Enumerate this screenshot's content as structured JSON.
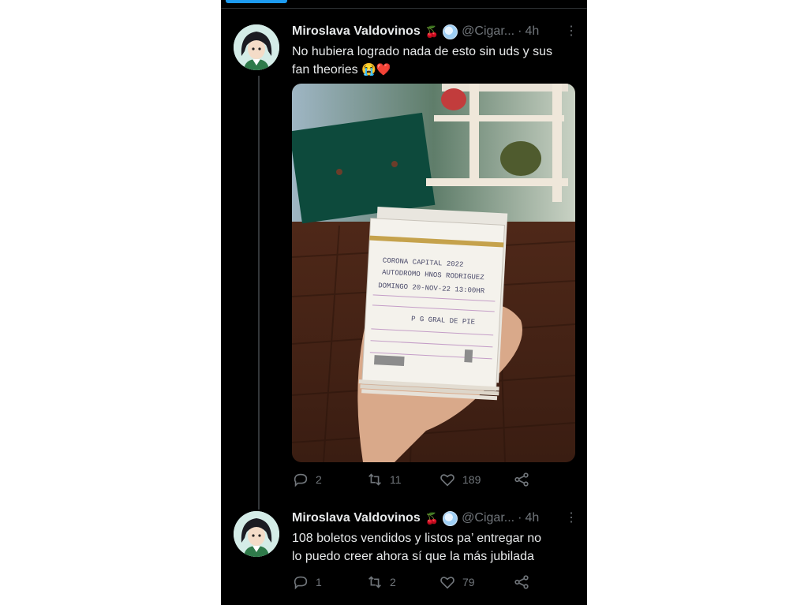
{
  "tweets": [
    {
      "author": "Miroslava Valdovinos",
      "badge_emoji": "🍒",
      "handle": "@Cigar...",
      "separator": "·",
      "time": "4h",
      "text_line1": "No hubiera logrado nada de esto sin uds y sus",
      "text_line2": "fan theories",
      "emojis": "😭❤️",
      "replies": "2",
      "retweets": "11",
      "likes": "189",
      "photo": {
        "ticket_lines": [
          "CORONA CAPITAL 2022",
          "AUTODROMO HNOS RODRIGUEZ",
          "DOMINGO  20-NOV-22 13:00HR",
          "P G GRAL DE PIE"
        ]
      }
    },
    {
      "author": "Miroslava Valdovinos",
      "badge_emoji": "🍒",
      "handle": "@Cigar...",
      "separator": "·",
      "time": "4h",
      "text_line1": "108 boletos vendidos y listos pa’ entregar no",
      "text_line2": "lo puedo creer ahora sí que la más jubilada",
      "replies": "1",
      "retweets": "2",
      "likes": "79"
    }
  ],
  "colors": {
    "background": "#000000",
    "text": "#e7e9ea",
    "muted": "#71767b",
    "accent": "#1d9bf0",
    "heart": "#f91880"
  },
  "icons": [
    "reply-icon",
    "retweet-icon",
    "like-icon",
    "share-icon",
    "more-icon",
    "globe-badge-icon"
  ]
}
